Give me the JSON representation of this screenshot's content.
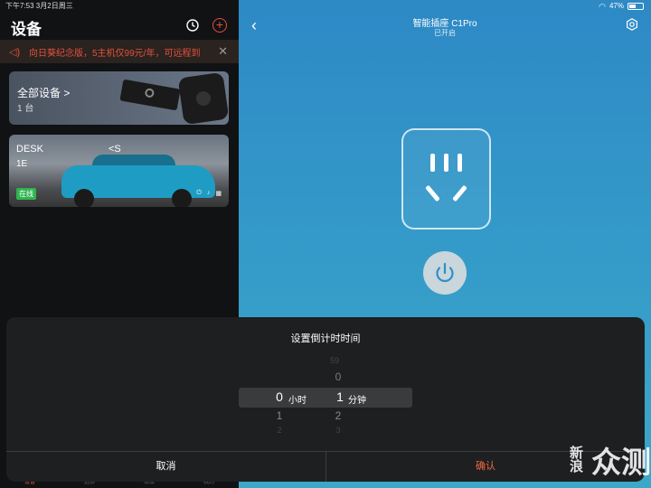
{
  "status_bar": {
    "time_date": "下午7:53   3月2日周三",
    "battery": "47%",
    "battery_level": 0.47
  },
  "devices": {
    "title": "设备",
    "promo_text": "向日葵纪念版，5主机仅99元/年，可远程到",
    "all_devices": {
      "label": "全部设备 >",
      "count": "1 台"
    },
    "device_card": {
      "name": "DESK",
      "name_tail": "<S",
      "sub": "1E",
      "status": "在线"
    },
    "tabs": [
      "设备",
      "远协",
      "发现",
      "我的"
    ]
  },
  "detail": {
    "title": "智能插座 C1Pro",
    "subtitle": "已开启"
  },
  "sheet": {
    "title": "设置倒计时时间",
    "hours_col": {
      "selected": "0",
      "unit": "小时",
      "below": [
        "1",
        "2"
      ]
    },
    "minutes_col": {
      "above": [
        "59",
        "0"
      ],
      "selected": "1",
      "unit": "分钟",
      "below": [
        "2",
        "3"
      ]
    },
    "cancel": "取消",
    "confirm": "确认"
  },
  "watermark": {
    "line1": "新浪",
    "line2": "众测"
  },
  "colors": {
    "accent": "#e4513c",
    "confirm": "#f06a43",
    "online": "#30b450"
  }
}
